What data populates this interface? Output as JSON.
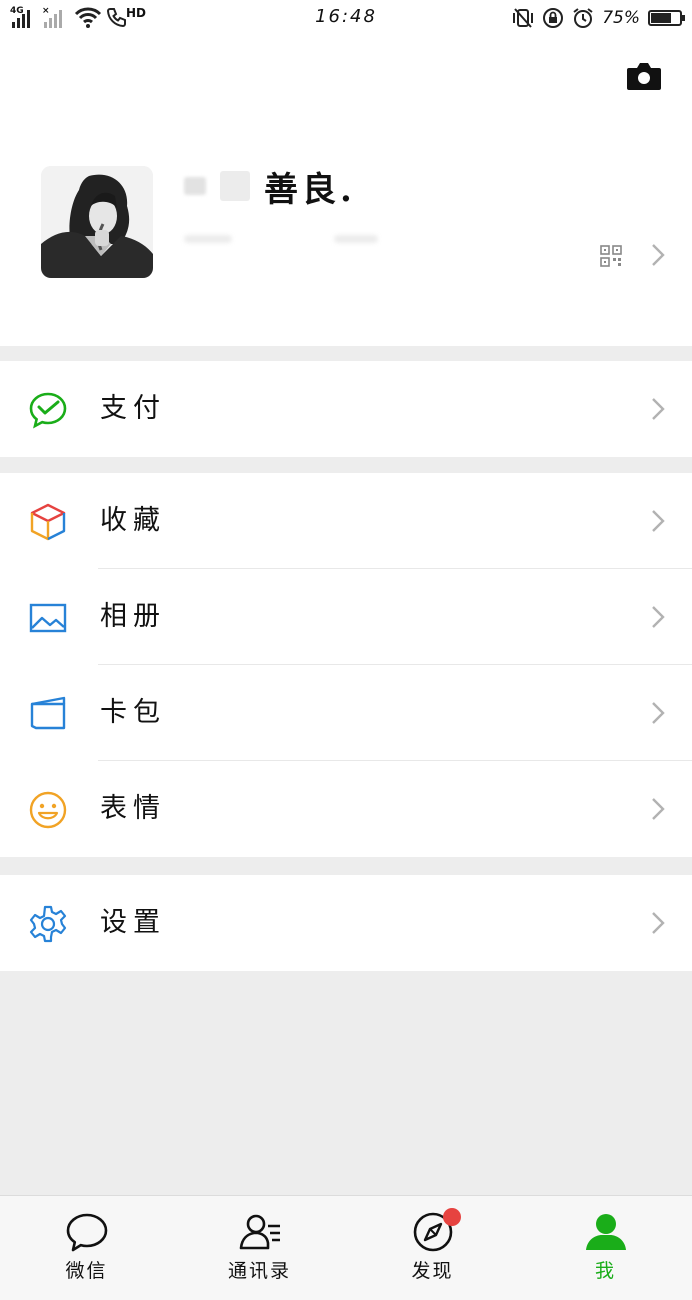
{
  "status_bar": {
    "network_1": "4G",
    "network_2": "×",
    "hd_label": "HD",
    "time": "16:48",
    "battery_percent_text": "75%",
    "battery_level": 0.75
  },
  "profile": {
    "name": "善良."
  },
  "menu": {
    "pay": {
      "label": "支付",
      "icon": "wechat-pay-icon",
      "color": "#1aad19"
    },
    "favorites": {
      "label": "收藏",
      "icon": "cube-icon"
    },
    "album": {
      "label": "相册",
      "icon": "image-icon",
      "color": "#2782d7"
    },
    "cards": {
      "label": "卡包",
      "icon": "wallet-icon",
      "color": "#2782d7"
    },
    "stickers": {
      "label": "表情",
      "icon": "smiley-icon",
      "color": "#f1a325"
    },
    "settings": {
      "label": "设置",
      "icon": "gear-icon",
      "color": "#2782d7"
    }
  },
  "tabbar": {
    "tabs": [
      {
        "label": "微信",
        "icon": "chat-bubble-icon",
        "active": false
      },
      {
        "label": "通讯录",
        "icon": "contacts-icon",
        "active": false
      },
      {
        "label": "发现",
        "icon": "compass-icon",
        "active": false,
        "badge": true
      },
      {
        "label": "我",
        "icon": "person-icon",
        "active": true
      }
    ],
    "active_color": "#1aad19",
    "badge_color": "#e64340"
  }
}
